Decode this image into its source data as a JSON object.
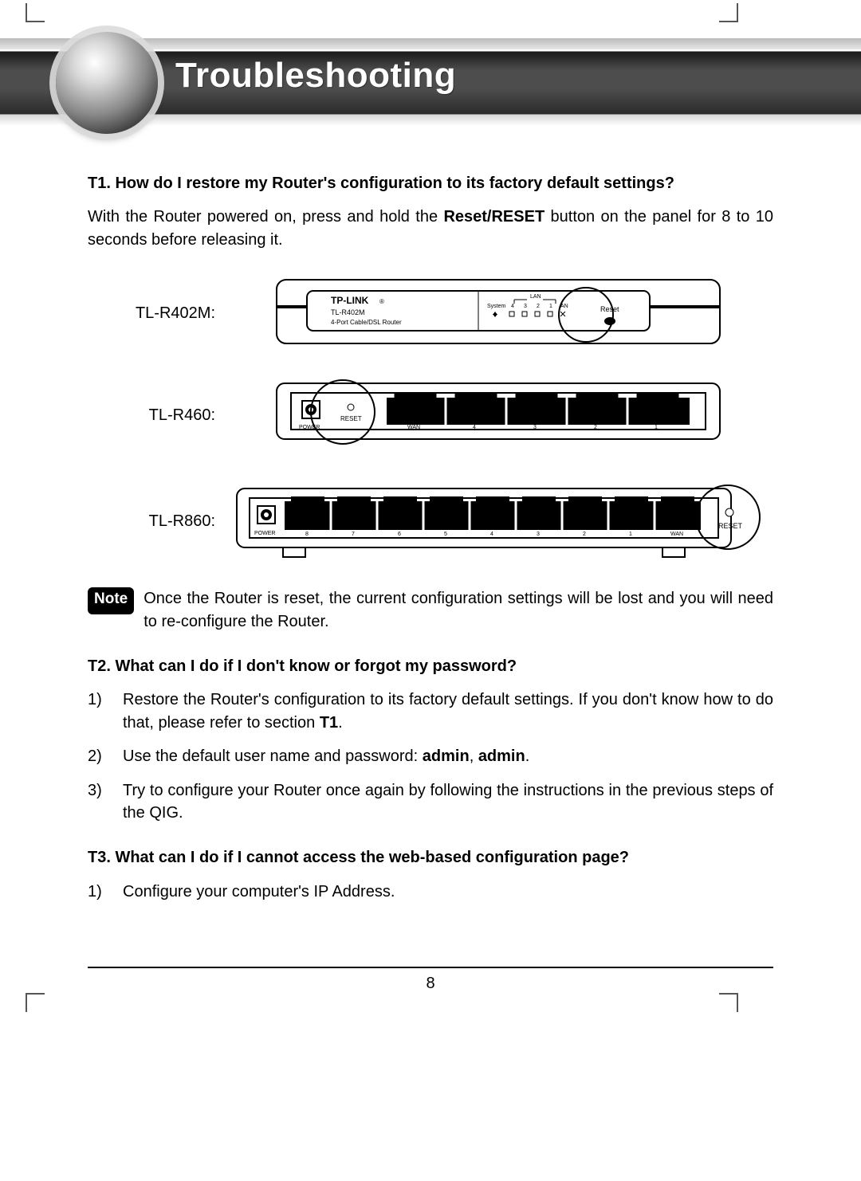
{
  "header": {
    "title": "Troubleshooting"
  },
  "t1": {
    "heading": "T1. How do I restore my Router's configuration to its factory default settings?",
    "p1_pre": "With the Router powered on, press and hold the ",
    "p1_bold": "Reset/RESET",
    "p1_post": " button on the panel for 8 to 10 seconds before releasing it."
  },
  "diagrams": {
    "r402m": {
      "label": "TL-R402M:"
    },
    "r460": {
      "label": "TL-R460:"
    },
    "r860": {
      "label": "TL-R860:"
    },
    "svgtext": {
      "brand": "TP-LINK",
      "model": "TL-R402M",
      "desc": "4-Port Cable/DSL Router",
      "lan": "LAN",
      "system": "System",
      "reset": "Reset",
      "reset_caps": "RESET",
      "power": "POWER",
      "wan": "WAN",
      "an": "AN",
      "n4": "4",
      "n3": "3",
      "n2": "2",
      "n1": "1",
      "n5": "5",
      "n6": "6",
      "n7": "7",
      "n8": "8"
    }
  },
  "note": {
    "badge": "Note",
    "text": "Once the Router is reset, the current configuration settings will be lost and you will need to re-configure the Router."
  },
  "t2": {
    "heading": "T2. What can I do if I don't know or forgot my password?",
    "items": {
      "a": {
        "num": "1)",
        "pre": "Restore the Router's configuration to its factory default settings. If you don't know how to do that, please refer to section ",
        "bold": "T1",
        "post": "."
      },
      "b": {
        "num": "2)",
        "pre": "Use the default user name and password: ",
        "b1": "admin",
        "sep": ", ",
        "b2": "admin",
        "post": "."
      },
      "c": {
        "num": "3)",
        "text": "Try to configure your Router once again by following the instructions in the previous steps of the QIG."
      }
    }
  },
  "t3": {
    "heading": "T3. What can I do if I cannot access the web-based configuration page?",
    "items": {
      "a": {
        "num": "1)",
        "text": "Configure your computer's IP Address."
      }
    }
  },
  "page_number": "8"
}
